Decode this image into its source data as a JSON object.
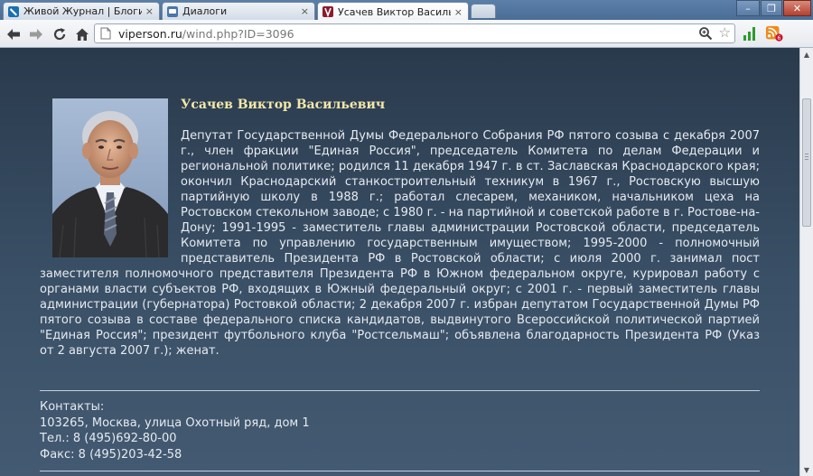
{
  "browser": {
    "tabs": [
      {
        "title": "Живой Журнал | Блоги |",
        "active": false
      },
      {
        "title": "Диалоги",
        "active": false
      },
      {
        "title": "Усачев Виктор Васильев",
        "active": true
      }
    ],
    "close_glyph": "×",
    "address": {
      "host": "viperson.ru",
      "path": "/wind.php?ID=3096"
    },
    "window_controls": {
      "minimize": "–",
      "maximize": "❐",
      "close": "✕"
    }
  },
  "page": {
    "person_name": "Усачев Виктор Васильевич",
    "biography": "Депутат Государственной Думы Федерального Собрания РФ пятого созыва с декабря 2007 г., член фракции \"Единая Россия\", председатель Комитета по делам Федерации и региональной политике; родился 11 декабря 1947 г. в ст. Заславская Краснодарского края; окончил Краснодарский станкостроительный техникум в 1967 г., Ростовскую высшую партийную школу в 1988 г.; работал слесарем, механиком, начальником цеха на Ростовском стекольном заводе; с 1980 г. - на партийной и советской работе в г. Ростове-на-Дону; 1991-1995 - заместитель главы администрации Ростовской области, председатель Комитета по управлению государственным имуществом; 1995-2000 - полномочный представитель Президента РФ в Ростовской области; с июля 2000 г. занимал пост заместителя полномочного представителя Президента РФ в Южном федеральном округе, курировал работу с органами власти субъектов РФ, входящих в Южный федеральный округ; с 2001 г. - первый заместитель главы администрации (губернатора) Ростовкой области; 2 декабря 2007 г. избран депутатом Государственной Думы РФ пятого созыва в составе федерального списка кандидатов, выдвинутого Всероссийской политической партией \"Единая Россия\"; президент футбольного клуба \"Ростсельмаш\"; объявлена благодарность Президента РФ (Указ от 2 августа 2007 г.); женат.",
    "contacts": {
      "heading": "Контакты:",
      "address": "103265, Москва, улица Охотный ряд, дом 1",
      "phone": "Тел.: 8 (495)692-80-00",
      "fax": "Факс: 8 (495)203-42-58"
    }
  },
  "colors": {
    "name": "#f2e8a8",
    "text": "#e6eaf0",
    "page_top": "#2a3a4d",
    "page_bottom": "#435a72"
  },
  "icons": [
    "livejournal-icon",
    "dialogs-icon",
    "viperson-icon",
    "back-icon",
    "forward-icon",
    "reload-icon",
    "home-icon",
    "page-icon",
    "zoom-icon",
    "star-icon",
    "signal-extension-icon",
    "rss-extension-icon"
  ]
}
